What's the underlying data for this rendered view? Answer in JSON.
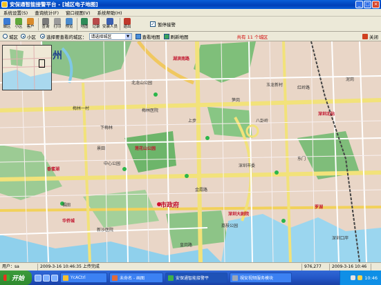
{
  "window": {
    "title": "安保通智能接警平台 - [城区电子地图]",
    "buttons": [
      "_",
      "□",
      "×"
    ]
  },
  "menu": [
    "系统设置(S)",
    "查询统计(F)",
    "窗口视图(V)",
    "系统帮助(H)"
  ],
  "toolbar": {
    "items": [
      "城区",
      "小区",
      "客户",
      "查询",
      "打印",
      "预览",
      "地图",
      "记录",
      "安装人员",
      "退出"
    ],
    "pause_label": "暂停接警",
    "pause_checked": true
  },
  "mapbar": {
    "radio_city": "城区",
    "radio_community": "小区",
    "select_prompt": "选择要查看的城区：",
    "select_value": "请选择城区",
    "view_button": "查看地图",
    "refresh_button": "刷新地图",
    "count_text": "共有 11 个城区",
    "close_button": "关闭"
  },
  "map": {
    "labels": {
      "city": "州",
      "l1": "北龙山公园",
      "l2": "湖滨南路",
      "l3": "梅林一村",
      "l4": "梅林医院",
      "l5": "中心公园",
      "l6": "莲花山公园",
      "l7": "市政府",
      "l8": "金霞路",
      "l9": "深圳市委",
      "l10": "深圳北站",
      "l11": "笋岗",
      "l12": "景田",
      "l13": "下梅林",
      "l14": "新沙医院",
      "l15": "罗湖",
      "l16": "深圳口岸",
      "l17": "福田",
      "l18": "香蜜湖",
      "l19": "东门",
      "l20": "玉龙新村",
      "l21": "红岭路",
      "l22": "华侨城",
      "l23": "深圳大剧院",
      "l24": "荔枝公园",
      "l25": "上步",
      "l26": "皇岗路",
      "l27": "八卦岭",
      "l28": "泥岗"
    }
  },
  "status": {
    "user": "用户：sa",
    "event": "2009-3-16 10:46:35 上传完成",
    "coords": "976,277",
    "datetime": "2009-3-16 10:46"
  },
  "taskbar": {
    "start": "开始",
    "tasks": [
      "YcACtrl",
      "未命名 - 画图",
      "安保通智能接警平",
      "視安视频服务模块"
    ],
    "clock": "10:46"
  }
}
